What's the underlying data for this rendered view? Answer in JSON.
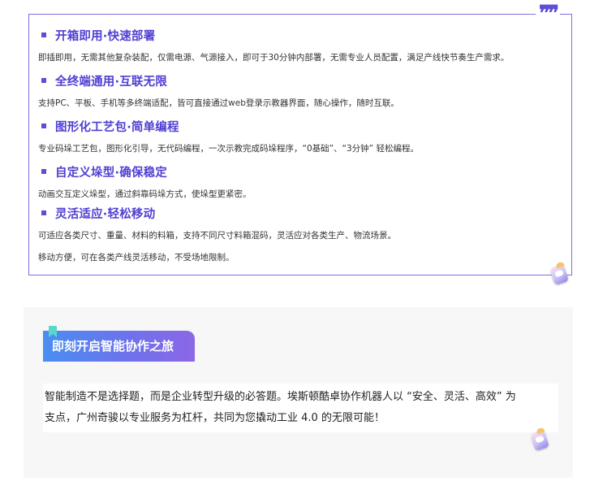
{
  "features": [
    {
      "title": "开箱即用·快速部署",
      "desc": [
        "即插即用，无需其他复杂装配，仅需电源、气源接入，即可于30分钟内部署，无需专业人员配置，满足产线快节奏生产需求。"
      ]
    },
    {
      "title": "全终端通用·互联无限",
      "desc": [
        "支持PC、平板、手机等多终端适配，皆可直接通过web登录示教器界面，随心操作，随时互联。"
      ]
    },
    {
      "title": "图形化工艺包·简单编程",
      "desc": [
        "专业码垛工艺包，图形化引导，无代码编程，一次示教完成码垛程序，“0基础”、“3分钟” 轻松编程。"
      ]
    },
    {
      "title": "自定义垛型·确保稳定",
      "desc": [
        "动画交互定义垛型，通过斜靠码垛方式，使垛型更紧密。"
      ]
    },
    {
      "title": "灵活适应·轻松移动",
      "desc": [
        "可适应各类尺寸、重量、材料的料箱，支持不同尺寸料箱混码，灵活应对各类生产、物流场景。",
        "移动方便，可在各类产线灵活移动，不受场地限制。"
      ]
    }
  ],
  "cta": {
    "heading": "即刻开启智能协作之旅",
    "line1": "智能制造不是选择题，而是企业转型升级的必答题。埃斯顿酷卓协作机器人以 “安全、灵活、高效” 为",
    "line2": "支点，广州奇骏以专业服务为杠杆，共同为您撬动工业 4.0 的无限可能！"
  },
  "icons": {
    "quote": "quote-mark-icon",
    "mascot": "robot-mascot-sticker",
    "flag": "bookmark-flag-icon"
  },
  "colors": {
    "accent": "#5b4fd6",
    "border": "#7b6fe0",
    "cta_gradient_start": "#4a8ef0",
    "cta_gradient_end": "#8c67e6",
    "flag": "#58d8c9"
  }
}
